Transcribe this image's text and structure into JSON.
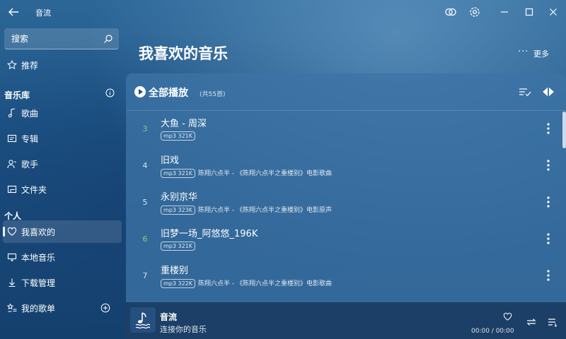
{
  "window": {
    "title": "音流"
  },
  "sidebar": {
    "search_placeholder": "搜索",
    "recommend": "推荐",
    "library_header": "音乐库",
    "library_items": [
      "歌曲",
      "专辑",
      "歌手",
      "文件夹"
    ],
    "personal_header": "个人",
    "personal_items": [
      "我喜欢的",
      "本地音乐",
      "下载管理",
      "我的歌单"
    ]
  },
  "main": {
    "title": "我喜欢的音乐",
    "more_label": "更多"
  },
  "playlist": {
    "play_all_label": "全部播放",
    "count_label": "(共55首)",
    "songs": [
      {
        "index": "3",
        "title": "大鱼 - 周深",
        "quality": "mp3 321K",
        "info": ""
      },
      {
        "index": "4",
        "title": "旧戏",
        "quality": "mp3 321K",
        "info": "陈翔六点半 - 《陈翔六点半之重楼别》电影歌曲"
      },
      {
        "index": "5",
        "title": "永别京华",
        "quality": "mp3 323K",
        "info": "陈翔六点半 - 《陈翔六点半之重楼别》电影原声"
      },
      {
        "index": "6",
        "title": "旧梦一场_阿悠悠_196K",
        "quality": "mp3 321K",
        "info": ""
      },
      {
        "index": "7",
        "title": "重楼别",
        "quality": "mp3 322K",
        "info": "陈翔六点半 - 《陈翔六点半之重楼别》电影歌曲"
      }
    ]
  },
  "player": {
    "title": "音流",
    "subtitle": "连接你的音乐",
    "time": "00:00 / 00:00"
  }
}
